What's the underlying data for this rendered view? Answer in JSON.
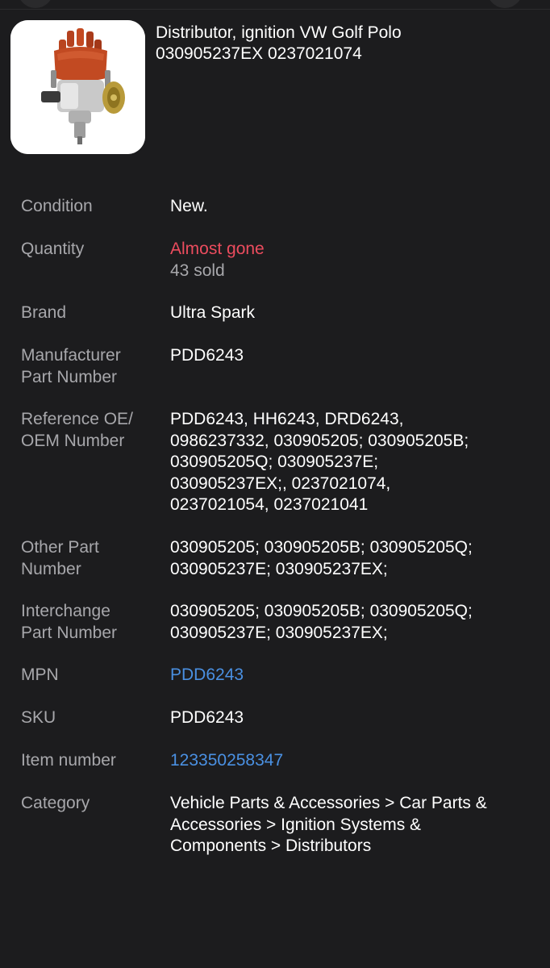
{
  "product": {
    "title_lines": [
      "Distributor, ignition VW Golf Polo",
      "030905237EX 0237021074"
    ],
    "image_alt": "distributor-product-photo"
  },
  "specs": {
    "condition": {
      "label": "Condition",
      "value": "New."
    },
    "quantity": {
      "label": "Quantity",
      "status": "Almost gone",
      "sold": "43 sold"
    },
    "brand": {
      "label": "Brand",
      "value": "Ultra Spark"
    },
    "manufacturer_part_number": {
      "label_lines": [
        "Manufacturer",
        "Part Number"
      ],
      "value": "PDD6243"
    },
    "reference_oe": {
      "label_lines": [
        "Reference OE/",
        "OEM Number"
      ],
      "value_lines": [
        "PDD6243, HH6243, DRD6243,",
        "0986237332, 030905205; 030905205B;",
        "030905205Q; 030905237E;",
        "030905237EX;, 0237021074,",
        "0237021054, 0237021041"
      ]
    },
    "other_part_number": {
      "label_lines": [
        "Other Part",
        "Number"
      ],
      "value_lines": [
        "030905205; 030905205B; 030905205Q;",
        "030905237E; 030905237EX;"
      ]
    },
    "interchange_part_number": {
      "label_lines": [
        "Interchange",
        "Part Number"
      ],
      "value_lines": [
        "030905205; 030905205B; 030905205Q;",
        "030905237E; 030905237EX;"
      ]
    },
    "mpn": {
      "label": "MPN",
      "value": "PDD6243"
    },
    "sku": {
      "label": "SKU",
      "value": "PDD6243"
    },
    "item_number": {
      "label": "Item number",
      "value": "123350258347"
    },
    "category": {
      "label": "Category",
      "value_lines": [
        "Vehicle Parts & Accessories > Car Parts &",
        "Accessories > Ignition Systems &",
        "Components > Distributors"
      ]
    }
  },
  "colors": {
    "background": "#1c1c1e",
    "label": "#a7a7ab",
    "link": "#4a90e2",
    "urgent": "#ec4c5e"
  }
}
